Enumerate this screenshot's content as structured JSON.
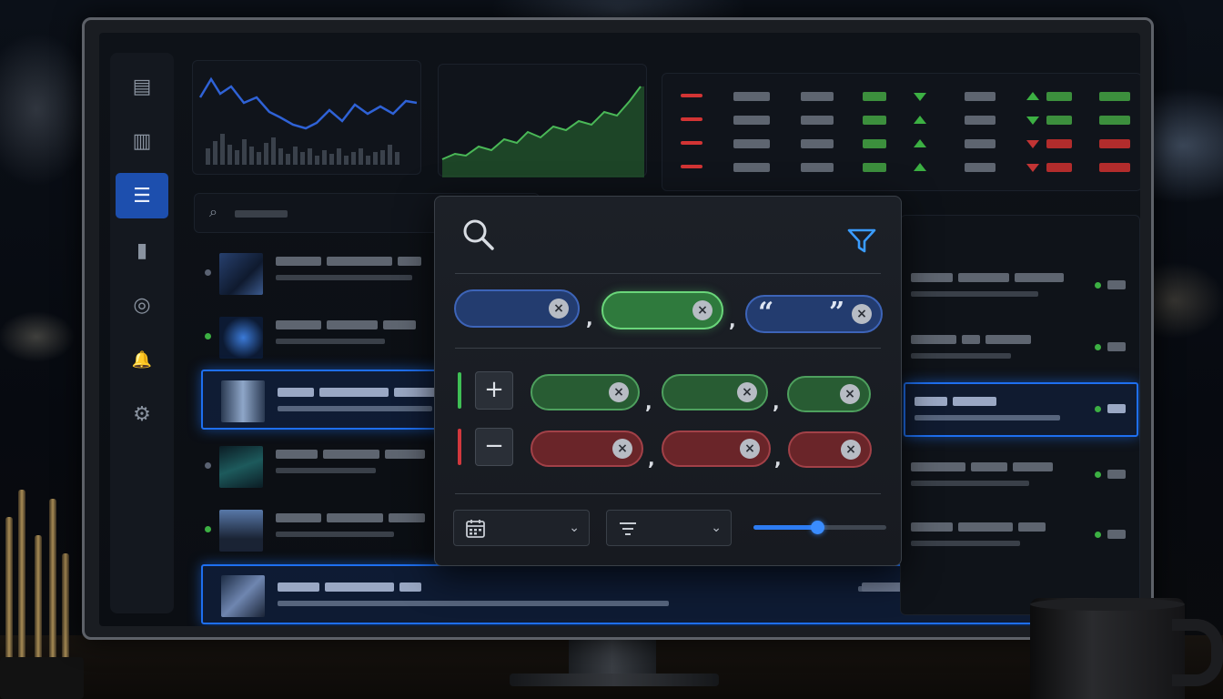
{
  "sidebar": {
    "items": [
      {
        "icon": "chat-icon",
        "glyph": "▤",
        "active": false
      },
      {
        "icon": "document-icon",
        "glyph": "▥",
        "active": false
      },
      {
        "icon": "list-icon",
        "glyph": "☰",
        "active": true
      },
      {
        "icon": "bar-chart-icon",
        "glyph": "▮",
        "active": false
      },
      {
        "icon": "target-icon",
        "glyph": "◎",
        "active": false
      },
      {
        "icon": "bell-icon",
        "glyph": "🔔",
        "active": false
      },
      {
        "icon": "gear-icon",
        "glyph": "⚙",
        "active": false
      }
    ]
  },
  "search_panel": {
    "icon": "search-icon"
  },
  "filter_popup": {
    "search_icon": "search-icon",
    "filter_icon": "funnel-icon",
    "terms": [
      {
        "type": "term",
        "style": "blue",
        "remove_glyph": "×"
      },
      {
        "type": "term",
        "style": "green-highlighted",
        "remove_glyph": "×"
      },
      {
        "type": "exact-phrase",
        "style": "blue",
        "open_quote": "“",
        "close_quote": "”",
        "remove_glyph": "×"
      }
    ],
    "separator": ",",
    "include": {
      "operator_glyph": "+",
      "tags": 3,
      "remove_glyph": "×"
    },
    "exclude": {
      "operator_glyph": "−",
      "tags": 3,
      "remove_glyph": "×"
    },
    "date_dropdown": {
      "icon": "calendar-icon",
      "chevron": "⌄"
    },
    "sort_dropdown": {
      "icon": "sort-icon",
      "chevron": "⌄"
    },
    "slider": {
      "value": 0.48
    }
  },
  "colors": {
    "accent": "#1e6ff0",
    "positive": "#3cb043",
    "negative": "#c23434"
  }
}
